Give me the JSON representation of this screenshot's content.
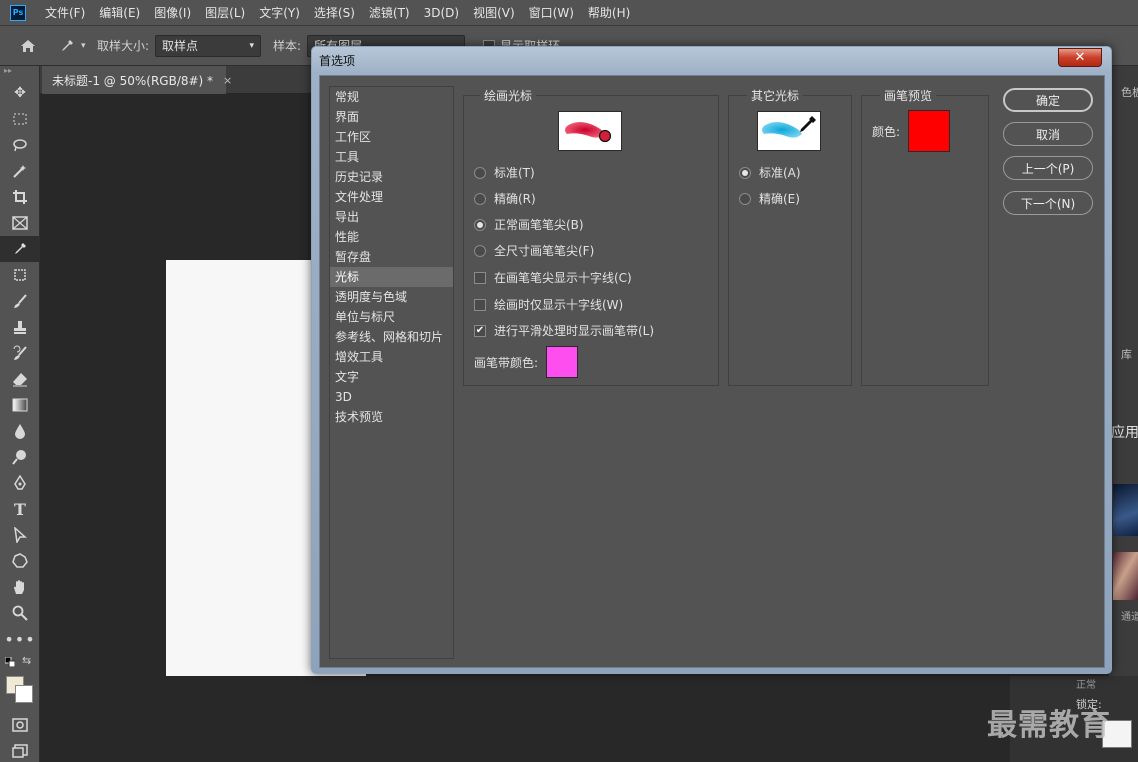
{
  "app": {
    "logo": "Ps"
  },
  "menu": [
    "文件(F)",
    "编辑(E)",
    "图像(I)",
    "图层(L)",
    "文字(Y)",
    "选择(S)",
    "滤镜(T)",
    "3D(D)",
    "视图(V)",
    "窗口(W)",
    "帮助(H)"
  ],
  "options": {
    "sample_size_label": "取样大小:",
    "sample_size_value": "取样点",
    "sample_label": "样本:",
    "sample_value": "所有图层",
    "show_ring_label": "显示取样环"
  },
  "document_tab": {
    "title": "未标题-1 @ 50%(RGB/8#) *",
    "close": "×"
  },
  "toolbox": {
    "collapse": "▸▸"
  },
  "right_panel": {
    "tab_color": "色板",
    "tab_lib": "库",
    "apply": "应用",
    "channels": "通道",
    "normal": "正常",
    "lock": "锁定:"
  },
  "watermark": "最需教育",
  "dialog": {
    "title": "首选项",
    "close": "✕",
    "categories": [
      "常规",
      "界面",
      "工作区",
      "工具",
      "历史记录",
      "文件处理",
      "导出",
      "性能",
      "暂存盘",
      "光标",
      "透明度与色域",
      "单位与标尺",
      "参考线、网格和切片",
      "增效工具",
      "文字",
      "3D",
      "技术预览"
    ],
    "selected_category": 9,
    "painting_cursors": {
      "title": "绘画光标",
      "options": [
        "标准(T)",
        "精确(R)",
        "正常画笔笔尖(B)",
        "全尺寸画笔笔尖(F)"
      ],
      "selected": 2,
      "checkboxes": [
        {
          "label": "在画笔笔尖显示十字线(C)",
          "checked": false
        },
        {
          "label": "绘画时仅显示十字线(W)",
          "checked": false
        },
        {
          "label": "进行平滑处理时显示画笔带(L)",
          "checked": true
        }
      ],
      "brush_band_color_label": "画笔带颜色:",
      "brush_band_color": "#ff4ef0"
    },
    "other_cursors": {
      "title": "其它光标",
      "options": [
        "标准(A)",
        "精确(E)"
      ],
      "selected": 0
    },
    "brush_preview": {
      "title": "画笔预览",
      "color_label": "颜色:",
      "color": "#ff0000"
    },
    "buttons": {
      "ok": "确定",
      "cancel": "取消",
      "prev": "上一个(P)",
      "next": "下一个(N)"
    },
    "check_mark": "✔"
  },
  "colors": {
    "foreground": "#efe9d6",
    "background": "#ffffff"
  }
}
